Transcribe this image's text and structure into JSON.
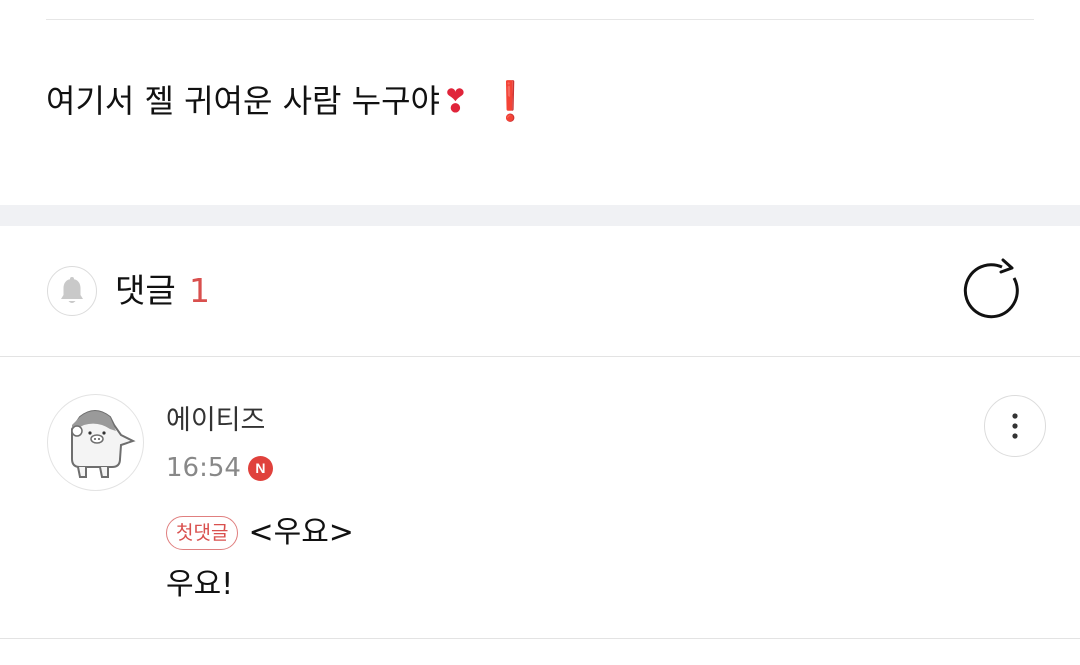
{
  "post": {
    "text": "여기서 젤 귀여운 사람 누구야",
    "heart_emoji": "❣",
    "exclamation_emoji": "❗"
  },
  "comments_header": {
    "label": "댓글",
    "count": "1",
    "bell_icon": "bell-icon",
    "refresh_icon": "refresh-icon"
  },
  "comment": {
    "author": "에이티즈",
    "time": "16:54",
    "new_badge": "N",
    "first_comment_badge": "첫댓글",
    "reply_title": "<우요>",
    "text": "우요!",
    "avatar_icon": "cartoon-avatar-icon",
    "more_icon": "more-vertical-icon"
  },
  "colors": {
    "accent_red": "#d9504e",
    "badge_red": "#e0413c",
    "section_gap": "#f0f1f4"
  }
}
